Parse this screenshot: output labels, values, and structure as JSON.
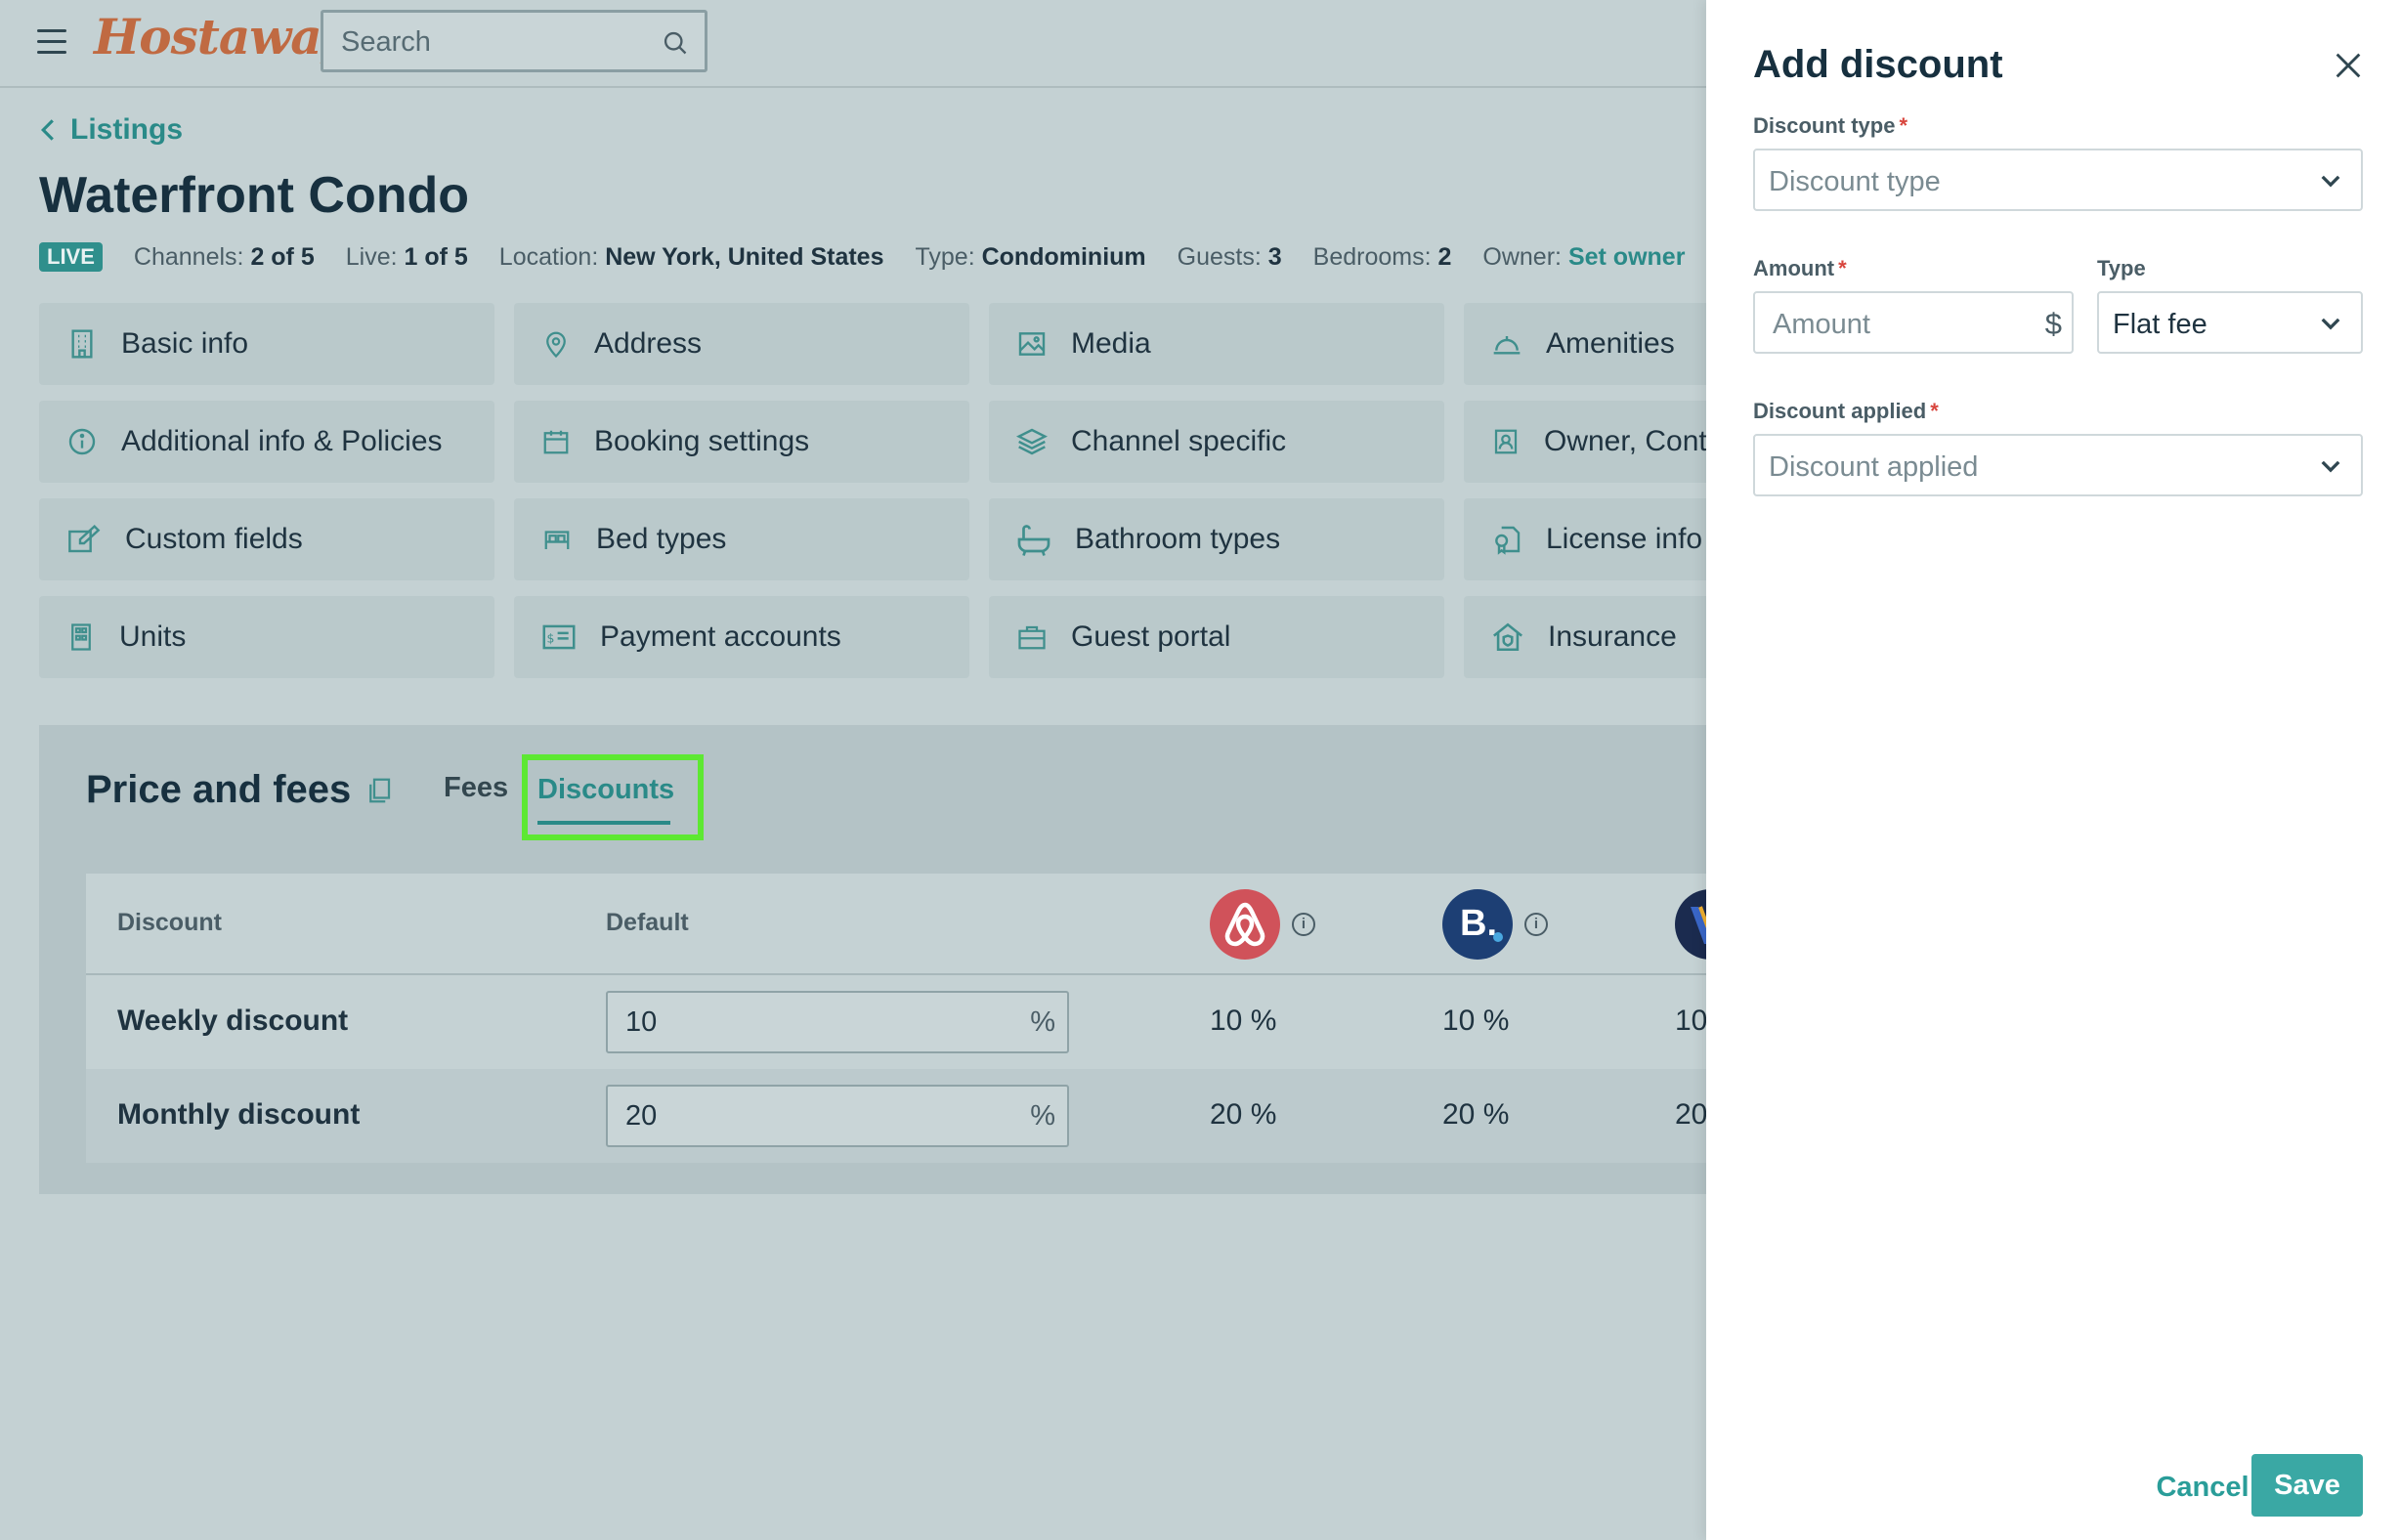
{
  "header": {
    "logo": "Hostaway",
    "search_placeholder": "Search"
  },
  "breadcrumb": "Listings",
  "listing": {
    "title": "Waterfront Condo",
    "status": "LIVE",
    "meta": [
      {
        "label": "Channels:",
        "value": "2 of 5"
      },
      {
        "label": "Live:",
        "value": "1 of 5"
      },
      {
        "label": "Location:",
        "value": "New York, United States"
      },
      {
        "label": "Type:",
        "value": "Condominium"
      },
      {
        "label": "Guests:",
        "value": "3"
      },
      {
        "label": "Bedrooms:",
        "value": "2"
      }
    ],
    "owner_label": "Owner:",
    "owner_link": "Set owner"
  },
  "tiles": [
    {
      "label": "Basic info",
      "icon": "building-icon"
    },
    {
      "label": "Address",
      "icon": "map-pin-icon"
    },
    {
      "label": "Media",
      "icon": "image-icon"
    },
    {
      "label": "Amenities",
      "icon": "service-bell-icon"
    },
    {
      "label": "Additional info & Policies",
      "icon": "info-icon"
    },
    {
      "label": "Booking settings",
      "icon": "calendar-icon"
    },
    {
      "label": "Channel specific",
      "icon": "layers-icon"
    },
    {
      "label": "Owner, Contacts",
      "icon": "contact-card-icon"
    },
    {
      "label": "Custom fields",
      "icon": "edit-icon"
    },
    {
      "label": "Bed types",
      "icon": "bed-icon"
    },
    {
      "label": "Bathroom types",
      "icon": "bathtub-icon"
    },
    {
      "label": "License info",
      "icon": "license-icon"
    },
    {
      "label": "Units",
      "icon": "units-icon"
    },
    {
      "label": "Payment accounts",
      "icon": "payment-card-icon"
    },
    {
      "label": "Guest portal",
      "icon": "briefcase-icon"
    },
    {
      "label": "Insurance",
      "icon": "home-shield-icon"
    }
  ],
  "price": {
    "title": "Price and fees",
    "tabs": {
      "fees": "Fees",
      "discounts": "Discounts"
    },
    "table": {
      "col_discount": "Discount",
      "col_default": "Default",
      "rows": [
        {
          "label": "Weekly discount",
          "default": "10",
          "unit": "%",
          "airbnb": "10 %",
          "booking": "10 %",
          "vrbo": "10"
        },
        {
          "label": "Monthly discount",
          "default": "20",
          "unit": "%",
          "airbnb": "20 %",
          "booking": "20 %",
          "vrbo": "20"
        }
      ],
      "booking_logo_text": "B."
    }
  },
  "drawer": {
    "title": "Add discount",
    "discount_type_label": "Discount type",
    "discount_type_placeholder": "Discount type",
    "amount_label": "Amount",
    "amount_placeholder": "Amount",
    "amount_unit": "$",
    "type_label": "Type",
    "type_value": "Flat fee",
    "applied_label": "Discount applied",
    "applied_placeholder": "Discount applied",
    "required_mark": "*",
    "cancel": "Cancel",
    "save": "Save"
  },
  "colors": {
    "accent": "#2a8a88",
    "highlight": "#5de832",
    "required": "#d8463e",
    "save": "#3aa8a4"
  }
}
